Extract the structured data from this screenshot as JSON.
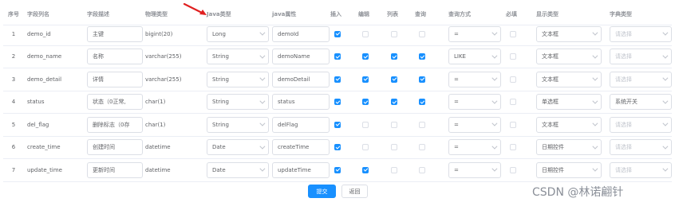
{
  "table": {
    "headers": {
      "idx": "序号",
      "column_name": "字段列名",
      "description": "字段描述",
      "physical_type": "物理类型",
      "java_type": "Java类型",
      "java_property": "java属性",
      "insert": "插入",
      "edit": "编辑",
      "list": "列表",
      "query": "查询",
      "query_type": "查询方式",
      "required": "必填",
      "display_type": "显示类型",
      "dict_type": "字典类型"
    },
    "rows": [
      {
        "idx": "1",
        "column_name": "demo_id",
        "description": "主键",
        "physical_type": "bigint(20)",
        "java_type": "Long",
        "java_property": "demoId",
        "insert": true,
        "edit": false,
        "list": false,
        "query": false,
        "query_type": "=",
        "required": false,
        "display_type": "文本框",
        "dict_type": "请选择",
        "dict_placeholder": true
      },
      {
        "idx": "2",
        "column_name": "demo_name",
        "description": "名称",
        "physical_type": "varchar(255)",
        "java_type": "String",
        "java_property": "demoName",
        "insert": true,
        "edit": true,
        "list": true,
        "query": true,
        "query_type": "LIKE",
        "required": false,
        "display_type": "文本框",
        "dict_type": "请选择",
        "dict_placeholder": true
      },
      {
        "idx": "3",
        "column_name": "demo_detail",
        "description": "详情",
        "physical_type": "varchar(255)",
        "java_type": "String",
        "java_property": "demoDetail",
        "insert": true,
        "edit": true,
        "list": true,
        "query": true,
        "query_type": "=",
        "required": false,
        "display_type": "文本框",
        "dict_type": "请选择",
        "dict_placeholder": true
      },
      {
        "idx": "4",
        "column_name": "status",
        "description": "状态（0正常,",
        "physical_type": "char(1)",
        "java_type": "String",
        "java_property": "status",
        "insert": true,
        "edit": true,
        "list": true,
        "query": true,
        "query_type": "=",
        "required": false,
        "display_type": "单选框",
        "dict_type": "系统开关",
        "dict_placeholder": false
      },
      {
        "idx": "5",
        "column_name": "del_flag",
        "description": "删除标志（0存",
        "physical_type": "char(1)",
        "java_type": "String",
        "java_property": "delFlag",
        "insert": true,
        "edit": false,
        "list": false,
        "query": false,
        "query_type": "=",
        "required": false,
        "display_type": "文本框",
        "dict_type": "请选择",
        "dict_placeholder": true
      },
      {
        "idx": "6",
        "column_name": "create_time",
        "description": "创建时间",
        "physical_type": "datetime",
        "java_type": "Date",
        "java_property": "createTime",
        "insert": true,
        "edit": false,
        "list": false,
        "query": false,
        "query_type": "=",
        "required": false,
        "display_type": "日期控件",
        "dict_type": "请选择",
        "dict_placeholder": true
      },
      {
        "idx": "7",
        "column_name": "update_time",
        "description": "更新时间",
        "physical_type": "datetime",
        "java_type": "Date",
        "java_property": "updateTime",
        "insert": true,
        "edit": true,
        "list": false,
        "query": false,
        "query_type": "=",
        "required": false,
        "display_type": "日期控件",
        "dict_type": "请选择",
        "dict_placeholder": true
      }
    ]
  },
  "actions": {
    "submit_label": "提交",
    "back_label": "返回"
  },
  "watermark": "CSDN @林诺翩针",
  "colors": {
    "primary": "#1890ff",
    "annotation_arrow": "#e02020"
  }
}
